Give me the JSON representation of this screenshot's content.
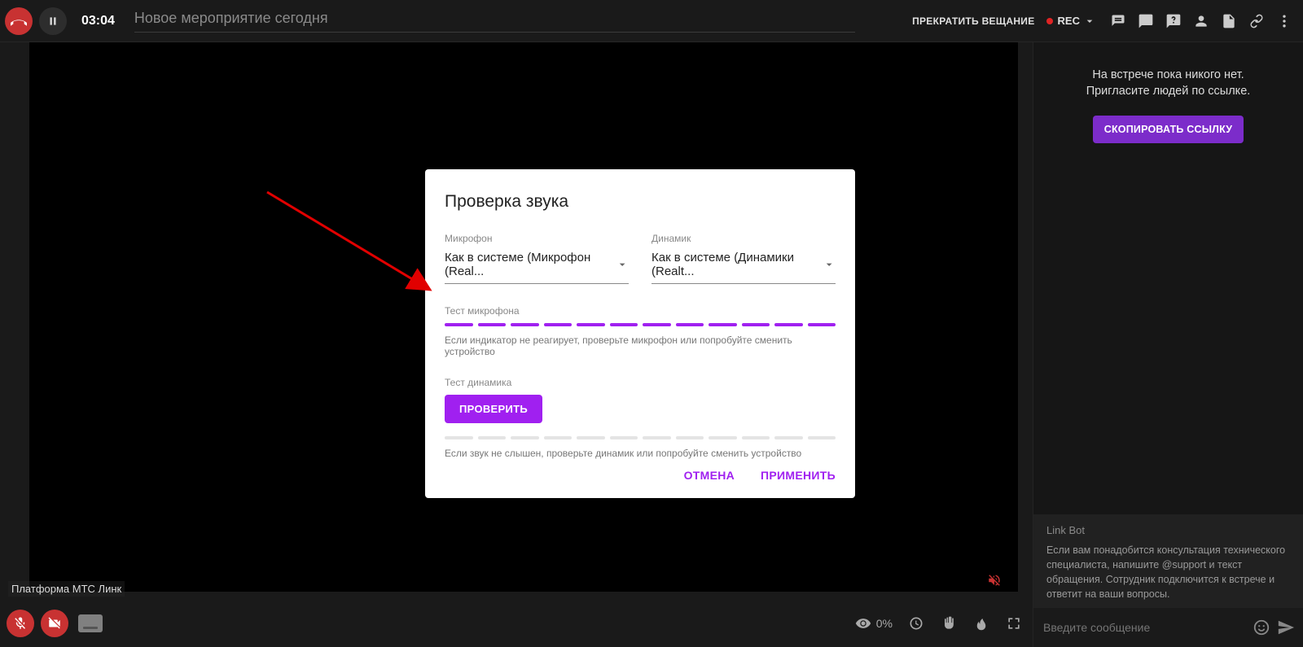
{
  "topbar": {
    "timer": "03:04",
    "event_title": "Новое мероприятие сегодня",
    "stop_broadcast": "ПРЕКРАТИТЬ ВЕЩАНИЕ",
    "rec_label": "REC"
  },
  "sidebar": {
    "empty_line1": "На встрече пока никого нет.",
    "empty_line2": "Пригласите людей по ссылке.",
    "copy_link": "СКОПИРОВАТЬ ССЫЛКУ",
    "bot_name": "Link Bot",
    "bot_message": "Если вам понадобится консультация технического специалиста, напишите @support и текст обращения. Сотрудник подключится к встрече и ответит на ваши вопросы.",
    "chat_placeholder": "Введите сообщение"
  },
  "platform_label": "Платформа МТС Линк",
  "bottom": {
    "viewers_pct": "0%"
  },
  "dialog": {
    "title": "Проверка звука",
    "mic_label": "Микрофон",
    "mic_value": "Как в системе (Микрофон (Real...",
    "speaker_label": "Динамик",
    "speaker_value": "Как в системе (Динамики (Realt...",
    "mic_test_label": "Тест микрофона",
    "mic_segments_on": 12,
    "mic_segments_total": 12,
    "mic_hint": "Если индикатор не реагирует, проверьте микрофон или попробуйте сменить устройство",
    "speaker_test_label": "Тест динамика",
    "check_btn": "ПРОВЕРИТЬ",
    "speaker_segments_on": 0,
    "speaker_segments_total": 12,
    "speaker_hint": "Если звук не слышен, проверьте динамик или попробуйте сменить устройство",
    "cancel": "ОТМЕНА",
    "apply": "ПРИМЕНИТЬ"
  }
}
